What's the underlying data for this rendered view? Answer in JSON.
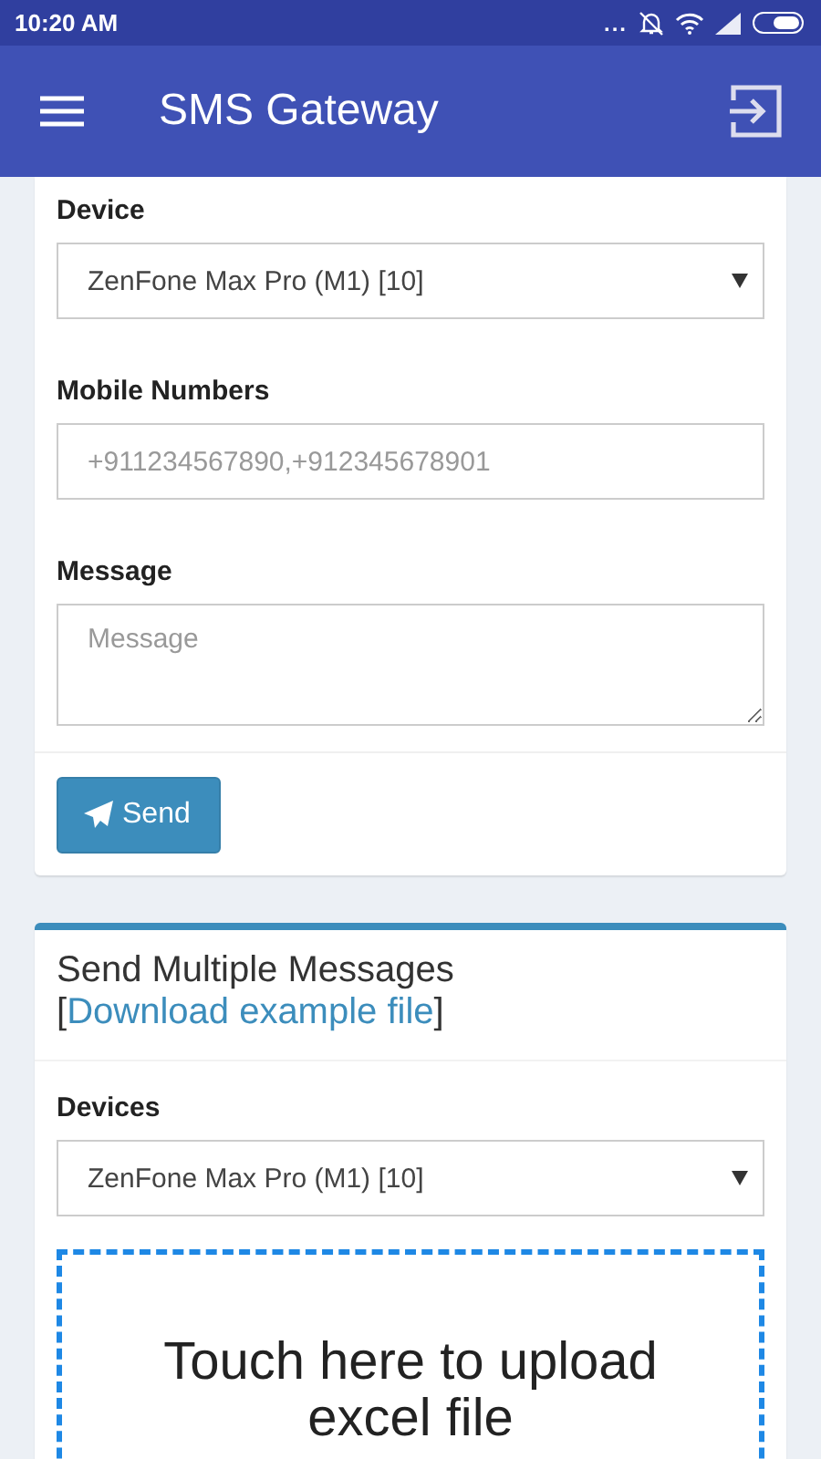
{
  "status_bar": {
    "time": "10:20 AM",
    "notifications": "..."
  },
  "app_bar": {
    "title": "SMS Gateway"
  },
  "single_message_form": {
    "fields": [
      {
        "kind": "select",
        "label": "Device",
        "value": "ZenFone Max Pro (M1) [10]"
      },
      {
        "kind": "input",
        "label": "Mobile Numbers",
        "placeholder": "+911234567890,+912345678901"
      },
      {
        "kind": "textarea",
        "label": "Message",
        "placeholder": "Message"
      }
    ],
    "button": "Send"
  },
  "multiple_messages_card": {
    "title": "Send Multiple Messages [",
    "link": "Download example file",
    "title_end": "]",
    "devices_label": "Devices",
    "devices_value": "ZenFone Max Pro (M1) [10]",
    "dropzone_text": "Touch here to upload excel file"
  }
}
